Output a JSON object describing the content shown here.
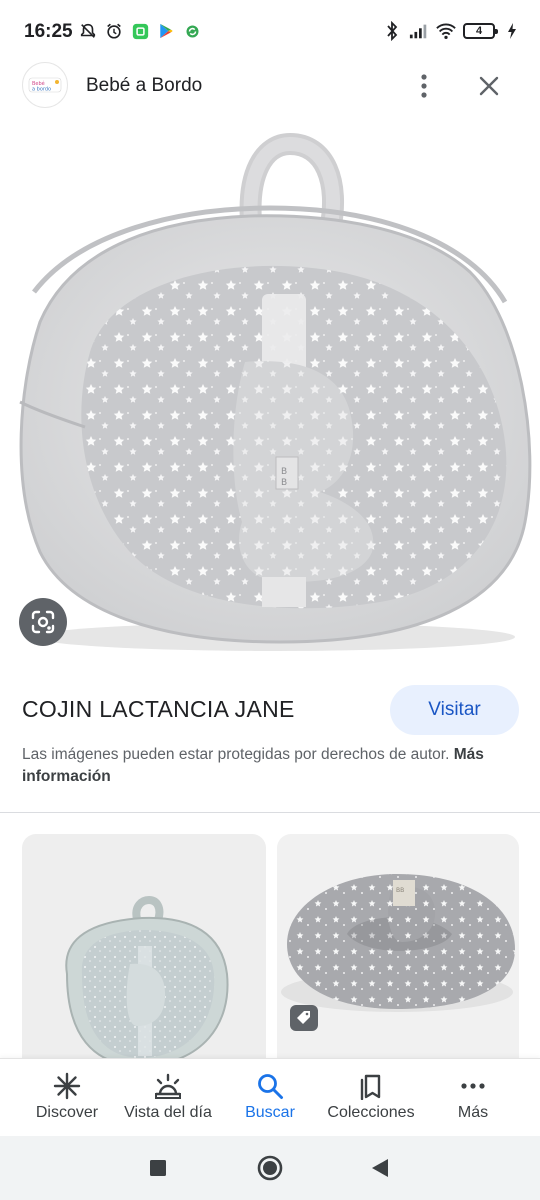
{
  "status_bar": {
    "time": "16:25",
    "battery_level": "4"
  },
  "header": {
    "site_name": "Bebé a Bordo",
    "logo_icon": "bebe-a-bordo-logo",
    "menu_icon": "more-vert-icon",
    "close_icon": "close-icon"
  },
  "main_image": {
    "subject": "nursing pillow in clear star-print carry bag",
    "lens_icon": "google-lens-icon"
  },
  "product": {
    "title": "COJIN LACTANCIA JANE",
    "visit_label": "Visitar",
    "copyright_text": "Las imágenes pueden estar protegidas por derechos de autor.",
    "more_info_label": "Más información"
  },
  "related": [
    {
      "subject": "nursing pillow in clear bag"
    },
    {
      "subject": "grey star-print nursing pillow",
      "badge_icon": "tag-icon"
    }
  ],
  "bottom_nav": {
    "items": [
      {
        "label": "Discover",
        "icon": "asterisk-icon",
        "active": false
      },
      {
        "label": "Vista del día",
        "icon": "sunrise-icon",
        "active": false
      },
      {
        "label": "Buscar",
        "icon": "search-icon",
        "active": true
      },
      {
        "label": "Colecciones",
        "icon": "bookmarks-icon",
        "active": false
      },
      {
        "label": "Más",
        "icon": "more-horiz-icon",
        "active": false
      }
    ]
  },
  "colors": {
    "accent": "#1a73e8",
    "visit_bg": "#e8f0fe",
    "text_primary": "#202124",
    "text_secondary": "#5f6368"
  }
}
